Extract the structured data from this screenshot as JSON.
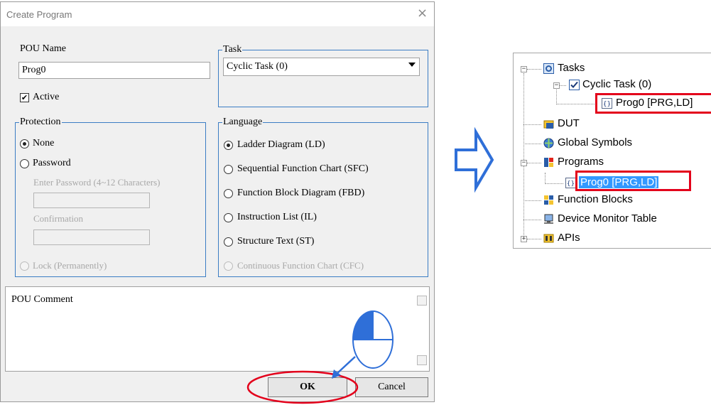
{
  "dialog": {
    "title": "Create Program",
    "close_glyph": "×",
    "pou_name_label": "POU Name",
    "pou_name_value": "Prog0",
    "active_label": "Active",
    "active_checked": true,
    "protection": {
      "title": "Protection",
      "none_label": "None",
      "password_label": "Password",
      "enter_password_label": "Enter Password (4~12 Characters)",
      "confirmation_label": "Confirmation",
      "lock_label": "Lock (Permanently)",
      "selected": "None"
    },
    "task": {
      "title": "Task",
      "selected": "Cyclic Task (0)"
    },
    "language": {
      "title": "Language",
      "options": [
        "Ladder Diagram (LD)",
        "Sequential Function Chart (SFC)",
        "Function Block Diagram (FBD)",
        "Instruction List (IL)",
        "Structure Text (ST)",
        "Continuous Function Chart (CFC)"
      ],
      "selected": "Ladder Diagram (LD)"
    },
    "comment_label": "POU Comment",
    "ok_label": "OK",
    "cancel_label": "Cancel"
  },
  "tree": {
    "tasks": "Tasks",
    "cyclic_task": "Cyclic Task (0)",
    "task_prog": "Prog0 [PRG,LD]",
    "dut": "DUT",
    "global_symbols": "Global Symbols",
    "programs": "Programs",
    "program_prog": "Prog0 [PRG,LD]",
    "function_blocks": "Function Blocks",
    "device_monitor_table": "Device Monitor Table",
    "apis": "APIs"
  },
  "colors": {
    "highlight_red": "#e3001b",
    "arrow_blue": "#2f6fd8",
    "selection_blue": "#3399ff",
    "group_border": "#3b7dc4"
  },
  "icons": [
    "close-icon",
    "checkbox-icon",
    "dropdown-arrow-icon",
    "scroll-up-icon",
    "scroll-down-icon",
    "cursor-click-icon",
    "tasks-icon",
    "cyclic-task-check-icon",
    "program-icon",
    "dut-icon",
    "global-symbols-icon",
    "programs-icon",
    "function-blocks-icon",
    "device-monitor-icon",
    "apis-icon",
    "right-arrow-icon"
  ]
}
